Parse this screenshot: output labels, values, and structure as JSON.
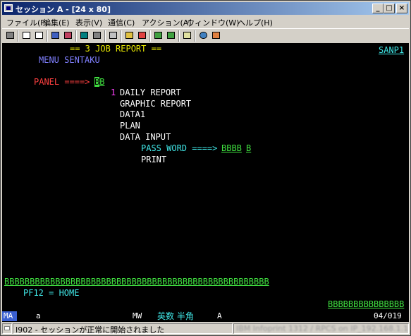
{
  "window": {
    "title": "セッション A - [24 x 80]",
    "icon": "terminal-session-icon",
    "controls": {
      "minimize": "_",
      "maximize": "□",
      "close": "×"
    }
  },
  "menu": [
    "ファイル(F)",
    "編集(E)",
    "表示(V)",
    "通信(C)",
    "アクション(A)",
    "ウィンドウ(W)",
    "ヘルプ(H)"
  ],
  "toolbar": {
    "buttons": [
      "print-screen",
      "copy",
      "paste",
      "send",
      "receive",
      "display-setup",
      "keyboard-map",
      "macro-play",
      "macro-record",
      "macro-stop",
      "file-transfer-send",
      "file-transfer-receive",
      "help",
      "web-link",
      "customize"
    ]
  },
  "screen": {
    "header": "== 3 JOB REPORT ==",
    "system_id": "SANP1",
    "menu_title": "MENU SENTAKU",
    "panel_label": "PANEL ====>",
    "panel_value": "BB",
    "selected_number": "1",
    "items": [
      "DAILY REPORT",
      "GRAPHIC REPORT",
      "DATA1",
      "PLAN",
      "DATA INPUT"
    ],
    "password_label": "PASS WORD ====>",
    "password_value_1": "BBBB",
    "password_value_2": "B",
    "print_item": "PRINT",
    "message_line": "BBBBBBBBBBBBBBBBBBBBBBBBBBBBBBBBBBBBBBBBBBBBBBBBBBBB",
    "pf_key": "PF12 = HOME",
    "bottom_field": "BBBBBBBBBBBBBBB"
  },
  "oia": {
    "ma": "MA",
    "session": "a",
    "mw": "MW",
    "input_mode": "英数 半角",
    "indicator": "A",
    "cursor_pos": "04/019"
  },
  "statusbar": {
    "icon": "connection-icon",
    "message": "I902 - セッションが正常に開始されました",
    "host_info": "IBM Infoprint 1312 / RPCS on IP_192.168.1.100"
  },
  "colors": {
    "title_start": "#0a246a",
    "title_end": "#a6caf0",
    "screen_bg": "#000000",
    "yellow": "#e8e800",
    "blue": "#8080ff",
    "red": "#ff4040",
    "white": "#ffffff",
    "cyan": "#40e8e8",
    "magenta": "#ff40ff",
    "green": "#40e040"
  }
}
